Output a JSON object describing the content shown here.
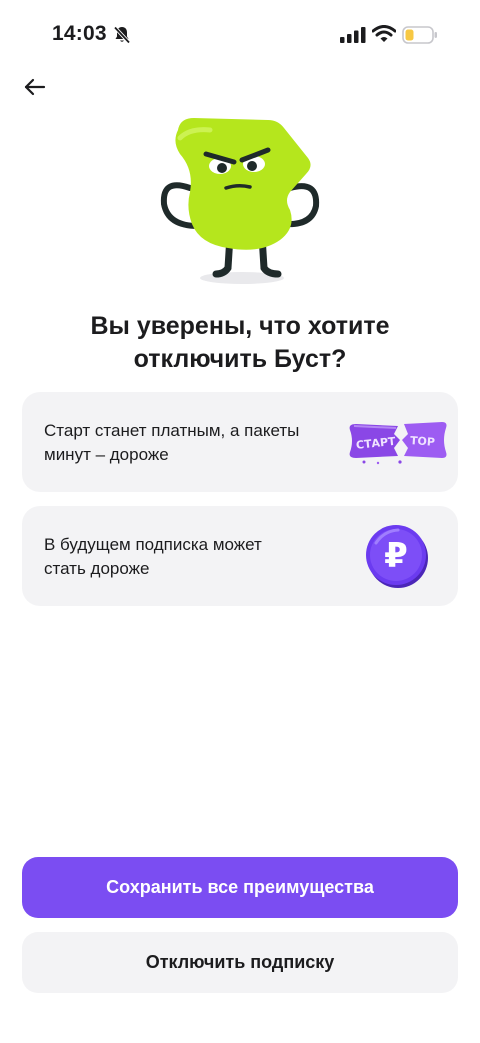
{
  "status_bar": {
    "time": "14:03",
    "icons": [
      "bell-slash-icon",
      "signal-icon",
      "wifi-icon",
      "battery-low-icon"
    ],
    "battery_color": "#f7c843"
  },
  "header": {
    "back_icon": "arrow-left-icon"
  },
  "mascot": {
    "icon": "green-mascot-character",
    "color": "#b5e61d"
  },
  "title": {
    "line1": "Вы уверены, что хотите",
    "line2": "отключить Буст?"
  },
  "cards": [
    {
      "text_line1": "Старт станет платным, а пакеты",
      "text_line2": "минут – дороже",
      "icon": "torn-ticket-icon",
      "icon_text": "СТАРТ",
      "icon_text_right": "ТОР"
    },
    {
      "text_line1": "В будущем подписка может",
      "text_line2": "стать дороже",
      "icon": "ruble-coin-icon",
      "icon_text": "₽"
    }
  ],
  "buttons": {
    "primary_label": "Сохранить все преимущества",
    "secondary_label": "Отключить подписку"
  },
  "colors": {
    "accent": "#7b4df2",
    "card_bg": "#f3f3f5",
    "text": "#1c1c1e"
  }
}
